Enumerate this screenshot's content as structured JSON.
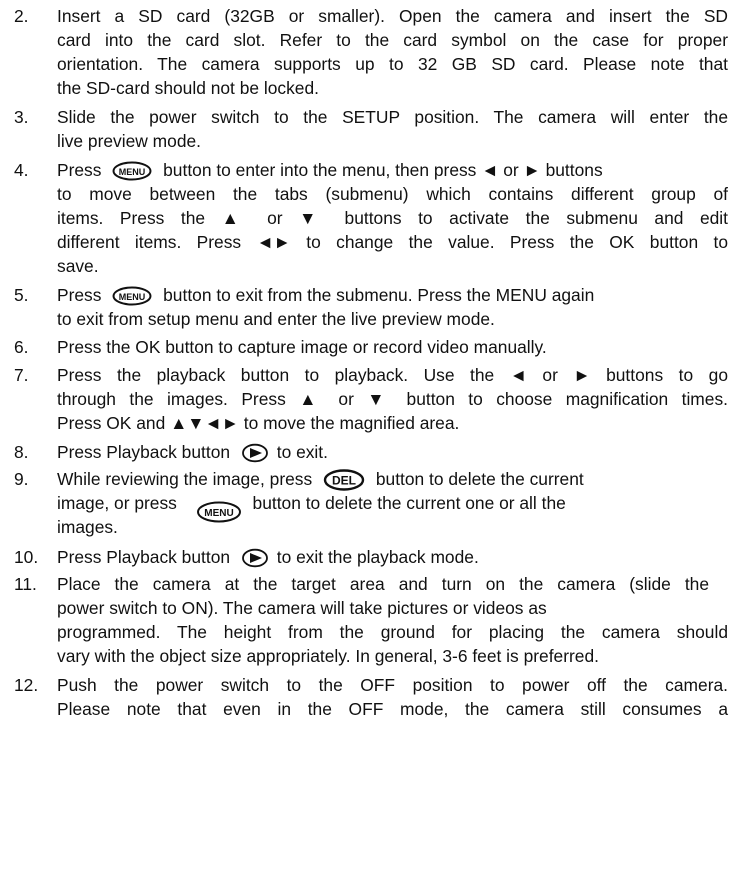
{
  "steps": [
    {
      "number": "2.",
      "lines": [
        "Insert a SD card (32GB or smaller). Open the camera and insert the SD",
        "card into the card slot. Refer to the card symbol on the case for proper",
        "orientation. The camera supports up to 32 GB SD card. Please note that",
        "the SD-card should not be locked."
      ]
    },
    {
      "number": "3.",
      "lines": [
        "Slide the power switch to the SETUP position. The camera will enter the",
        "live preview mode."
      ]
    },
    {
      "number": "4.",
      "line1_a": "Press",
      "line1_b": "button to enter into the menu, then press ◄ or ► buttons",
      "lines": [
        "to move between the tabs (submenu) which contains different group of",
        "items. Press the ▲ or ▼ buttons to activate the submenu and edit",
        "different items. Press ◄► to change the value. Press the OK button to",
        "save."
      ]
    },
    {
      "number": "5.",
      "line1_a": "Press",
      "line1_b": "button to exit from the submenu. Press the MENU again",
      "lines": [
        "to exit from setup menu and enter the live preview mode."
      ]
    },
    {
      "number": "6.",
      "lines": [
        "Press the OK button to capture image or record video manually."
      ]
    },
    {
      "number": "7.",
      "lines": [
        "Press the playback button to playback. Use the ◄ or ► buttons to go",
        "through the images. Press ▲ or ▼ button to choose magnification times.",
        "Press OK and ▲▼◄► to move the magnified area."
      ]
    },
    {
      "number": "8.",
      "line1_a": "Press Playback button",
      "line1_b": "to exit."
    },
    {
      "number": "9.",
      "line1_a": "While reviewing the image, press",
      "line1_b": "button to delete the current",
      "line2_a": "image, or press",
      "line2_b": "button to delete the current one or all the",
      "lines": [
        "images."
      ]
    },
    {
      "number": "10.",
      "line1_a": "Press Playback button",
      "line1_b": "to exit the playback mode."
    },
    {
      "number": "11.",
      "lines": [
        "Place the camera at the target area and turn on the camera (slide the",
        "power switch to ON). The camera will take pictures or videos as",
        "programmed. The height from the ground for placing the camera should",
        "vary with the object size appropriately. In general, 3-6 feet is preferred."
      ]
    },
    {
      "number": "12.",
      "lines": [
        "Push the power switch to the OFF position to power off the camera.",
        "Please note that even in the OFF mode, the camera still consumes a"
      ]
    }
  ],
  "icons": {
    "menu": "MENU",
    "del": "DEL"
  }
}
